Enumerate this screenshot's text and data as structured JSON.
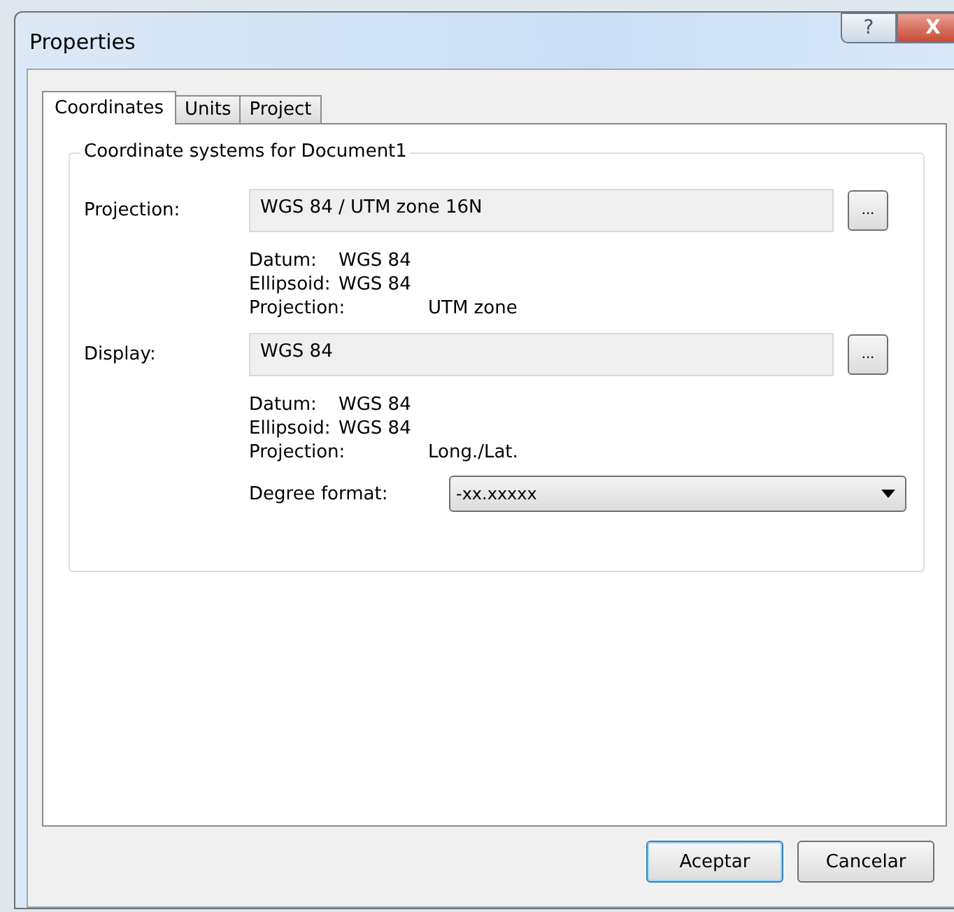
{
  "window": {
    "title": "Properties",
    "help": "?",
    "close": "X"
  },
  "tabs": [
    {
      "label": "Coordinates",
      "selected": true
    },
    {
      "label": "Units",
      "selected": false
    },
    {
      "label": "Project",
      "selected": false
    }
  ],
  "group": {
    "title": "Coordinate systems for Document1",
    "systems": [
      {
        "label": "Projection:",
        "value": "WGS 84 / UTM zone 16N",
        "browse": "...",
        "details": [
          {
            "label": "Datum:",
            "value": "WGS 84"
          },
          {
            "label": "Ellipsoid:",
            "value": "WGS 84"
          },
          {
            "label": "Projection:",
            "value": "UTM zone"
          }
        ]
      },
      {
        "label": "Display:",
        "value": "WGS 84",
        "browse": "...",
        "details": [
          {
            "label": "Datum:",
            "value": "WGS 84"
          },
          {
            "label": "Ellipsoid:",
            "value": "WGS 84"
          },
          {
            "label": "Projection:",
            "value": "Long./Lat."
          }
        ]
      }
    ],
    "degree_format": {
      "label": "Degree format:",
      "value": "-xx.xxxxx"
    }
  },
  "buttons": [
    {
      "label": "Aceptar",
      "default": true
    },
    {
      "label": "Cancelar",
      "default": false
    }
  ]
}
